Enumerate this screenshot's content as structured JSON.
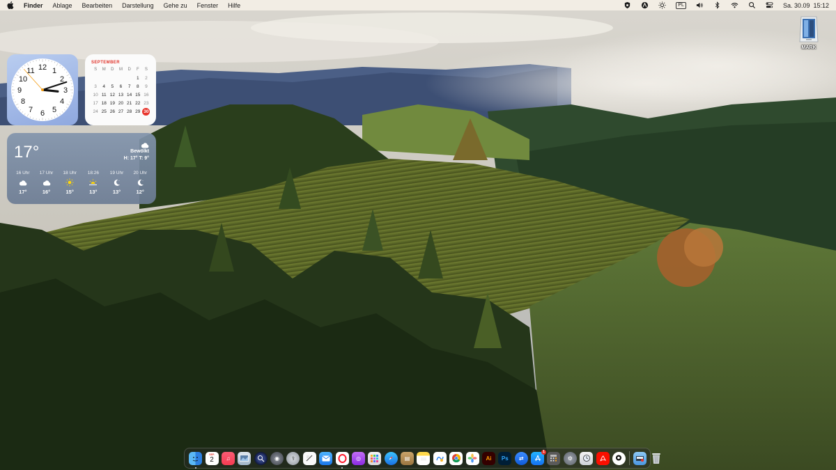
{
  "menubar": {
    "app_name": "Finder",
    "menus": [
      "Ablage",
      "Bearbeiten",
      "Darstellung",
      "Gehe zu",
      "Fenster",
      "Hilfe"
    ],
    "status_icons": [
      "shield-icon",
      "bartender-icon",
      "brightness-icon",
      "keyboard-input-icon",
      "volume-icon",
      "bluetooth-icon",
      "wifi-icon",
      "spotlight-icon",
      "control-center-icon"
    ],
    "input_source": "PL",
    "datetime": "Sa. 30.09  15:12"
  },
  "desktop": {
    "drive_label": "MARK"
  },
  "clock_widget": {
    "numbers": [
      "12",
      "1",
      "2",
      "3",
      "4",
      "5",
      "6",
      "7",
      "8",
      "9",
      "10",
      "11"
    ],
    "time": "15:12"
  },
  "calendar_widget": {
    "month": "SEPTEMBER",
    "weekdays": [
      "S",
      "M",
      "D",
      "M",
      "D",
      "F",
      "S"
    ],
    "weeks": [
      [
        "",
        "",
        "",
        "",
        "",
        "1",
        "2"
      ],
      [
        "3",
        "4",
        "5",
        "6",
        "7",
        "8",
        "9"
      ],
      [
        "10",
        "11",
        "12",
        "13",
        "14",
        "15",
        "16"
      ],
      [
        "17",
        "18",
        "19",
        "20",
        "21",
        "22",
        "23"
      ],
      [
        "24",
        "25",
        "26",
        "27",
        "28",
        "29",
        "30"
      ]
    ],
    "today": "30"
  },
  "weather_widget": {
    "temperature": "17°",
    "condition": "Bewölkt",
    "high_low": "H: 17° T: 9°",
    "condition_icon": "cloud-icon",
    "hourly": [
      {
        "time": "16 Uhr",
        "icon": "cloud-icon",
        "temp": "17°"
      },
      {
        "time": "17 Uhr",
        "icon": "cloud-icon",
        "temp": "16°"
      },
      {
        "time": "18 Uhr",
        "icon": "sun-icon",
        "temp": "15°"
      },
      {
        "time": "18:26",
        "icon": "sunset-icon",
        "temp": "13°"
      },
      {
        "time": "19 Uhr",
        "icon": "moon-icon",
        "temp": "13°"
      },
      {
        "time": "20 Uhr",
        "icon": "moon-icon",
        "temp": "12°"
      }
    ]
  },
  "dock": {
    "calendar_icon_month": "SEP.",
    "calendar_icon_day": "2",
    "apps": [
      "finder",
      "calendar",
      "music",
      "preview",
      "magnifier",
      "migration",
      "disk-utility",
      "textedit",
      "mail",
      "opera",
      "podcasts",
      "launchpad",
      "safari",
      "archive",
      "notes",
      "freeform",
      "chrome",
      "photos",
      "illustrator",
      "photoshop",
      "teamviewer",
      "app-store",
      "calculator",
      "system-settings",
      "downloads",
      "acrobat",
      "webcam",
      "downloads-folder",
      "trash"
    ],
    "app_store_badge": "1",
    "illustrator_label": "Ai",
    "photoshop_label": "Ps"
  }
}
